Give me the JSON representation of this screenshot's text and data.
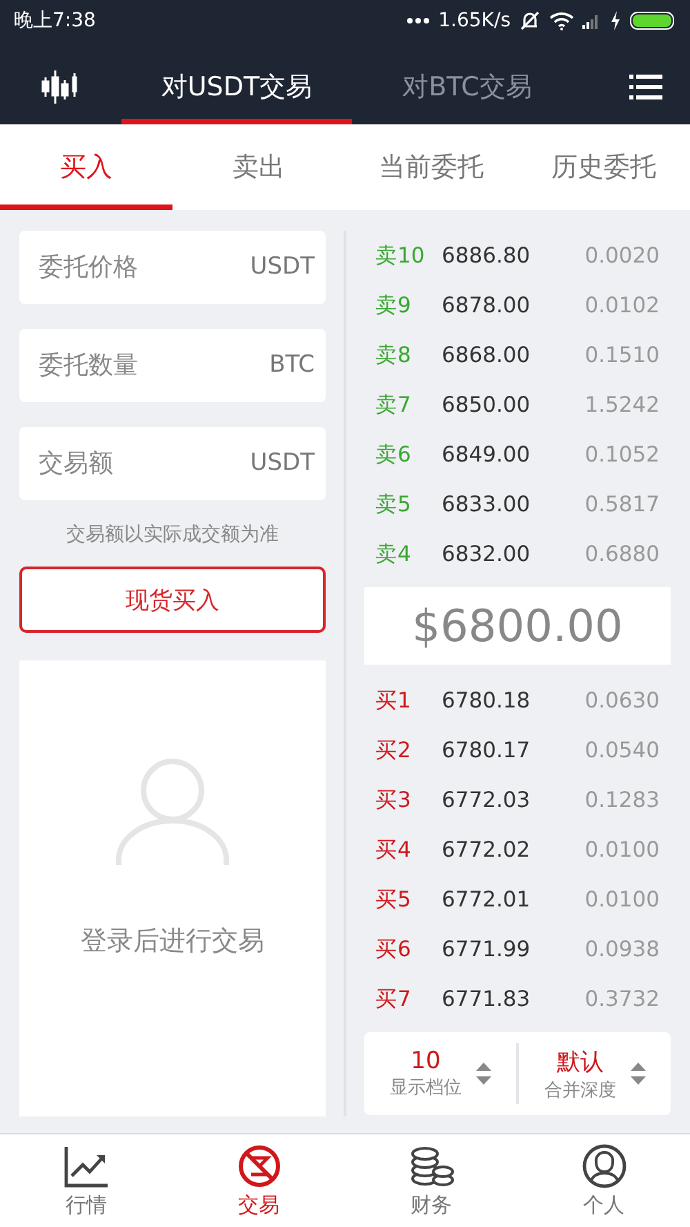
{
  "status_bar": {
    "time": "晚上7:38",
    "speed": "1.65K/s"
  },
  "header": {
    "tabs": [
      {
        "label": "对USDT交易",
        "selected": true
      },
      {
        "label": "对BTC交易",
        "selected": false
      }
    ]
  },
  "sub_tabs": [
    {
      "label": "买入",
      "selected": true
    },
    {
      "label": "卖出",
      "selected": false
    },
    {
      "label": "当前委托",
      "selected": false
    },
    {
      "label": "历史委托",
      "selected": false
    }
  ],
  "order_form": {
    "fields": [
      {
        "placeholder": "委托价格",
        "unit": "USDT"
      },
      {
        "placeholder": "委托数量",
        "unit": "BTC"
      },
      {
        "placeholder": "交易额",
        "unit": "USDT"
      }
    ],
    "note": "交易额以实际成交额为准",
    "submit_button": "现货买入",
    "login_prompt": "登录后进行交易"
  },
  "order_book": {
    "asks": [
      {
        "label": "卖10",
        "price": "6886.80",
        "amount": "0.0020"
      },
      {
        "label": "卖9",
        "price": "6878.00",
        "amount": "0.0102"
      },
      {
        "label": "卖8",
        "price": "6868.00",
        "amount": "0.1510"
      },
      {
        "label": "卖7",
        "price": "6850.00",
        "amount": "1.5242"
      },
      {
        "label": "卖6",
        "price": "6849.00",
        "amount": "0.1052"
      },
      {
        "label": "卖5",
        "price": "6833.00",
        "amount": "0.5817"
      },
      {
        "label": "卖4",
        "price": "6832.00",
        "amount": "0.6880"
      }
    ],
    "last_price": "$6800.00",
    "bids": [
      {
        "label": "买1",
        "price": "6780.18",
        "amount": "0.0630"
      },
      {
        "label": "买2",
        "price": "6780.17",
        "amount": "0.0540"
      },
      {
        "label": "买3",
        "price": "6772.03",
        "amount": "0.1283"
      },
      {
        "label": "买4",
        "price": "6772.02",
        "amount": "0.0100"
      },
      {
        "label": "买5",
        "price": "6772.01",
        "amount": "0.0100"
      },
      {
        "label": "买6",
        "price": "6771.99",
        "amount": "0.0938"
      },
      {
        "label": "买7",
        "price": "6771.83",
        "amount": "0.3732"
      }
    ],
    "depth_controls": [
      {
        "value": "10",
        "label": "显示档位"
      },
      {
        "value": "默认",
        "label": "合并深度"
      }
    ]
  },
  "bottom_nav": [
    {
      "label": "行情",
      "selected": false
    },
    {
      "label": "交易",
      "selected": true
    },
    {
      "label": "财务",
      "selected": false
    },
    {
      "label": "个人",
      "selected": false
    }
  ]
}
